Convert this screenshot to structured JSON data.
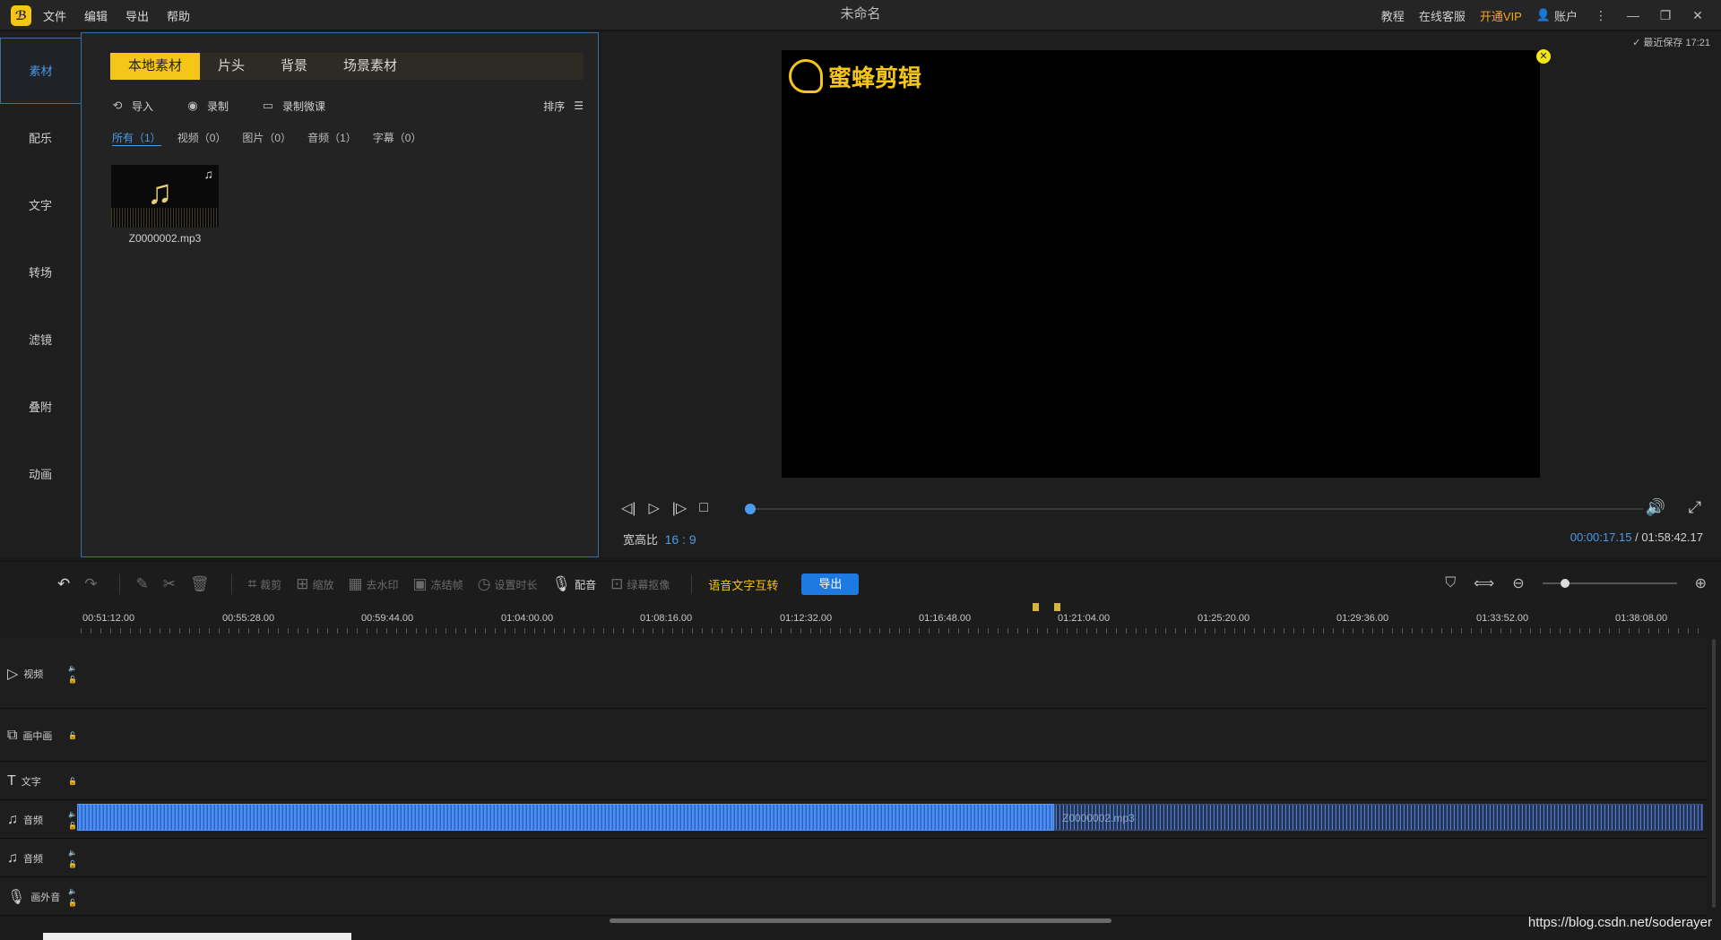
{
  "app": {
    "title": "未命名",
    "logo": "bee-logo-icon"
  },
  "menu": [
    "文件",
    "编辑",
    "导出",
    "帮助"
  ],
  "right_menu": {
    "tutorial": "教程",
    "support": "在线客服",
    "vip": "开通VIP",
    "account": "账户"
  },
  "sidebar": [
    "素材",
    "配乐",
    "文字",
    "转场",
    "滤镜",
    "叠附",
    "动画"
  ],
  "media": {
    "tabs": [
      "本地素材",
      "片头",
      "背景",
      "场景素材"
    ],
    "actions": {
      "import": "导入",
      "record": "录制",
      "record_course": "录制微课",
      "sort": "排序"
    },
    "filters": [
      "所有（1）",
      "视频（0）",
      "图片（0）",
      "音频（1）",
      "字幕（0）"
    ],
    "item": {
      "name": "Z0000002.mp3"
    }
  },
  "preview": {
    "save_status": "最近保存 17:21",
    "brand": "蜜蜂剪辑",
    "progress": 0.002,
    "ratio_label": "宽高比",
    "ratio_value": "16 : 9",
    "time_current": "00:00:17.15",
    "time_sep": "/",
    "time_total": "01:58:42.17"
  },
  "toolbar": {
    "crop": "裁剪",
    "zoom": "缩放",
    "watermark": "去水印",
    "freeze": "冻结帧",
    "duration": "设置时长",
    "dub": "配音",
    "greenscreen": "绿幕抠像",
    "speech": "语音文字互转",
    "export": "导出"
  },
  "ruler": [
    "00:51:12.00",
    "00:55:28.00",
    "00:59:44.00",
    "01:04:00.00",
    "01:08:16.00",
    "01:12:32.00",
    "01:16:48.00",
    "01:21:04.00",
    "01:25:20.00",
    "01:29:36.00",
    "01:33:52.00",
    "01:38:08.00"
  ],
  "tracks": {
    "video": "视频",
    "pip": "画中画",
    "text": "文字",
    "audio1": "音频",
    "audio2": "音频",
    "voiceover": "画外音"
  },
  "clip_label": "Z0000002.mp3",
  "watermark": "https://blog.csdn.net/soderayer",
  "colors": {
    "accent": "#f5c518",
    "blue": "#4a9be8",
    "export": "#1e7ae0"
  }
}
